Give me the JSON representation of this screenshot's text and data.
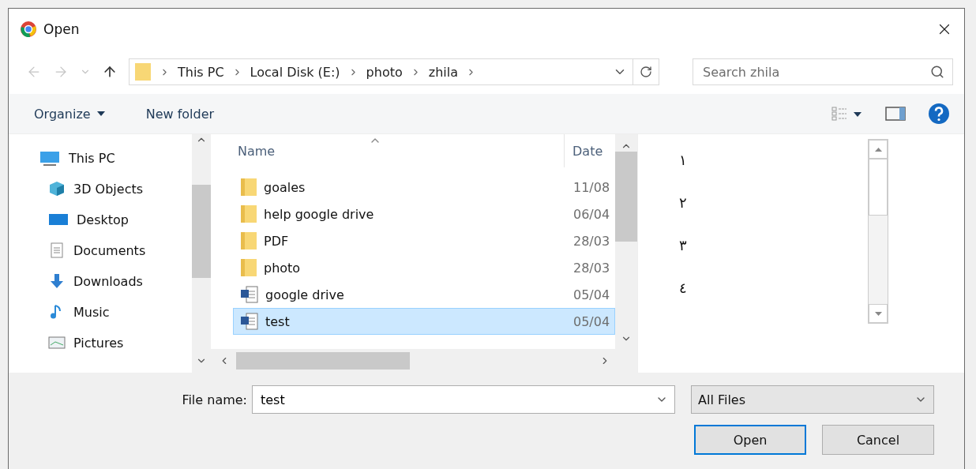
{
  "window": {
    "title": "Open"
  },
  "breadcrumb": [
    "This PC",
    "Local Disk (E:)",
    "photo",
    "zhila"
  ],
  "search": {
    "placeholder": "Search zhila"
  },
  "toolbar": {
    "organize": "Organize",
    "new_folder": "New folder"
  },
  "sidebar": {
    "items": [
      {
        "label": "This PC",
        "kind": "pc",
        "children": [
          {
            "label": "3D Objects",
            "kind": "objects"
          },
          {
            "label": "Desktop",
            "kind": "desktop"
          },
          {
            "label": "Documents",
            "kind": "documents"
          },
          {
            "label": "Downloads",
            "kind": "downloads"
          },
          {
            "label": "Music",
            "kind": "music"
          },
          {
            "label": "Pictures",
            "kind": "pictures"
          }
        ]
      }
    ]
  },
  "files": {
    "columns": [
      "Name",
      "Date"
    ],
    "rows": [
      {
        "name": "goales",
        "date": "11/08",
        "kind": "folder",
        "selected": false
      },
      {
        "name": "help google drive",
        "date": "06/04",
        "kind": "folder",
        "selected": false
      },
      {
        "name": "PDF",
        "date": "28/03",
        "kind": "folder",
        "selected": false
      },
      {
        "name": "photo",
        "date": "28/03",
        "kind": "folder",
        "selected": false
      },
      {
        "name": "google drive",
        "date": "05/04",
        "kind": "document",
        "selected": false
      },
      {
        "name": "test",
        "date": "05/04",
        "kind": "document",
        "selected": true
      }
    ]
  },
  "preview": {
    "lines": [
      "١",
      "٢",
      "٣",
      "٤"
    ]
  },
  "file_name": {
    "label": "File name:",
    "value": "test"
  },
  "filter": {
    "value": "All Files"
  },
  "buttons": [
    {
      "label": "Open",
      "kind": "primary"
    },
    {
      "label": "Cancel",
      "kind": "secondary"
    }
  ]
}
